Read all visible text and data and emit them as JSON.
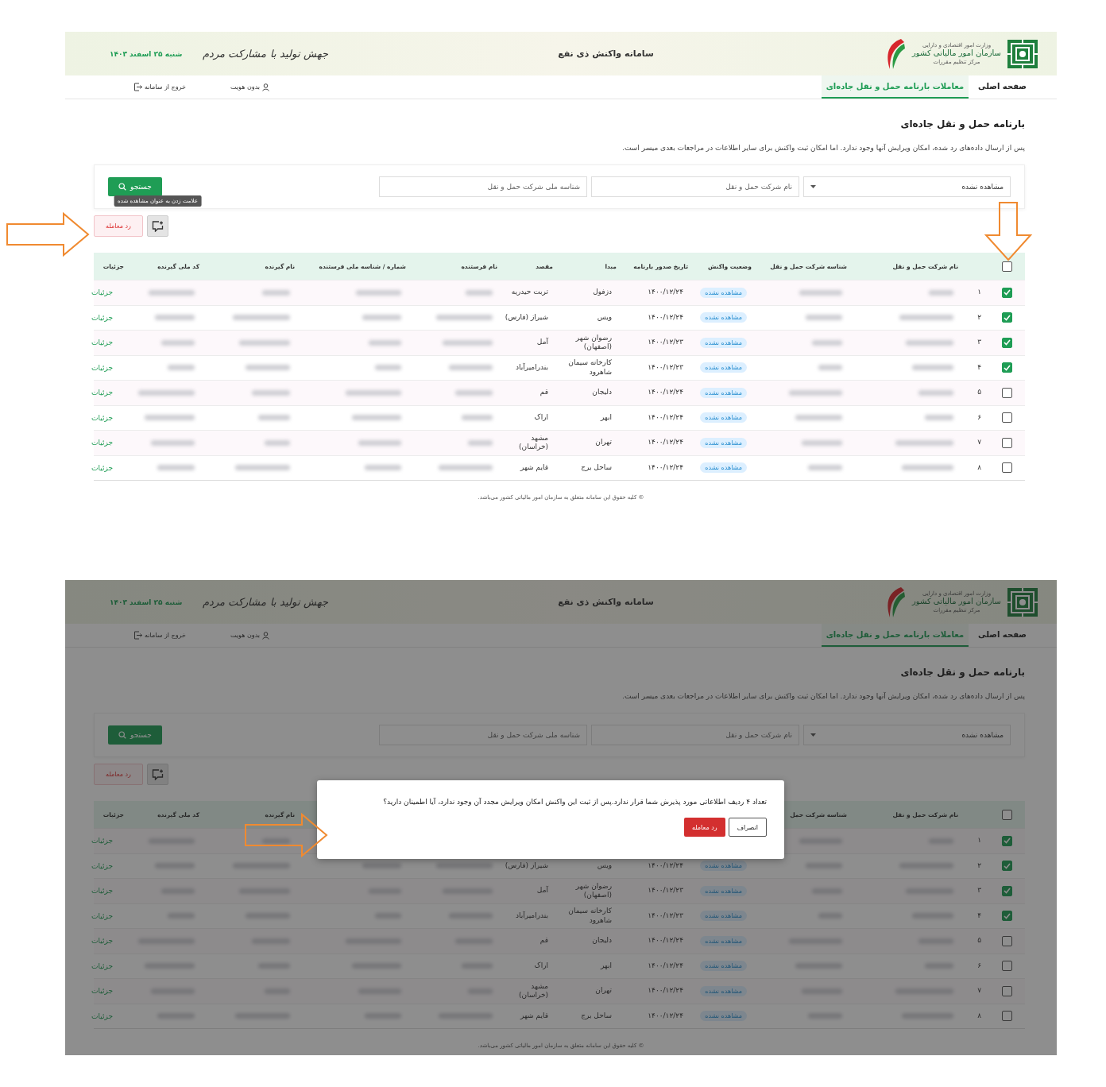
{
  "screens": [
    {
      "dimmed": false,
      "banner": {
        "ministry": "وزارت امور اقتصادی و دارایی",
        "organization": "سازمان امور مالیاتی کشور",
        "unit": "مرکز تنظیم مقررات",
        "title": "سامانه واکنش ذی نفع",
        "slogan": "جهش تولید با مشارکت مردم",
        "date": "شنبه ۲۵ اسفند ۱۴۰۳"
      },
      "nav": {
        "items": [
          {
            "label": "صفحه اصلی",
            "selected": false
          },
          {
            "label": "معاملات بارنامه حمل و نقل جاده‌ای",
            "selected": true
          }
        ],
        "user": "بدون هویت",
        "logout": "خروج از سامانه"
      },
      "page_title": "بارنامه حمل و نقل جاده‌ای",
      "description": "پس از ارسال داده‌های رد شده، امکان ویرایش آنها وجود ندارد. اما امکان ثبت واکنش برای سایر اطلاعات در مراجعات بعدی میسر است.",
      "filters": {
        "status": "مشاهده نشده",
        "company_name": {
          "placeholder": "نام شرکت حمل و نقل"
        },
        "company_id": {
          "placeholder": "شناسه ملی شرکت حمل و نقل"
        },
        "search_button": "جستجو"
      },
      "tooltip": "علامت زدن به عنوان مشاهده شده",
      "reject_button": "رد معامله",
      "table": {
        "header_checked": false,
        "columns": [
          null,
          null,
          "نام شرکت حمل و نقل",
          "شناسه شرکت حمل و نقل",
          "وضعیت واکنش",
          "تاریخ صدور بارنامه",
          "مبدا",
          "مقصد",
          "نام فرستنده",
          "شماره / شناسه ملی فرستنده",
          "نام گیرنده",
          "کد ملی گیرنده",
          "جزئیات"
        ],
        "rows": [
          {
            "checked": true,
            "number": "۱",
            "status": "مشاهده نشده",
            "date": "۱۴۰۰/۱۲/۲۴",
            "origin": "دزفول",
            "destination": "تربت حیدریه",
            "details": "جزئیات"
          },
          {
            "checked": true,
            "number": "۲",
            "status": "مشاهده نشده",
            "date": "۱۴۰۰/۱۲/۲۴",
            "origin": "ویس",
            "destination": "شیراز (فارس)",
            "details": "جزئیات"
          },
          {
            "checked": true,
            "number": "۳",
            "status": "مشاهده نشده",
            "date": "۱۴۰۰/۱۲/۲۳",
            "origin": "رضوان شهر (اصفهان)",
            "destination": "آمل",
            "details": "جزئیات"
          },
          {
            "checked": true,
            "number": "۴",
            "status": "مشاهده نشده",
            "date": "۱۴۰۰/۱۲/۲۳",
            "origin": "کارخانه سیمان شاهرود",
            "destination": "بندرامیرآباد",
            "details": "جزئیات"
          },
          {
            "checked": false,
            "number": "۵",
            "status": "مشاهده نشده",
            "date": "۱۴۰۰/۱۲/۲۴",
            "origin": "دلیجان",
            "destination": "قم",
            "details": "جزئیات"
          },
          {
            "checked": false,
            "number": "۶",
            "status": "مشاهده نشده",
            "date": "۱۴۰۰/۱۲/۲۴",
            "origin": "ابهر",
            "destination": "اراک",
            "details": "جزئیات"
          },
          {
            "checked": false,
            "number": "۷",
            "status": "مشاهده نشده",
            "date": "۱۴۰۰/۱۲/۲۴",
            "origin": "تهران",
            "destination": "مشهد (خراسان)",
            "details": "جزئیات"
          },
          {
            "checked": false,
            "number": "۸",
            "status": "مشاهده نشده",
            "date": "۱۴۰۰/۱۲/۲۴",
            "origin": "ساحل برج",
            "destination": "قایم شهر",
            "details": "جزئیات"
          }
        ]
      },
      "footer": "© کلیه حقوق این سامانه متعلق به سازمان امور مالیاتی کشور می‌باشد."
    },
    {
      "dimmed": true,
      "banner": {
        "ministry": "وزارت امور اقتصادی و دارایی",
        "organization": "سازمان امور مالیاتی کشور",
        "unit": "مرکز تنظیم مقررات",
        "title": "سامانه واکنش ذی نفع",
        "slogan": "جهش تولید با مشارکت مردم",
        "date": "شنبه ۲۵ اسفند ۱۴۰۳"
      },
      "nav": {
        "items": [
          {
            "label": "صفحه اصلی",
            "selected": false
          },
          {
            "label": "معاملات بارنامه حمل و نقل جاده‌ای",
            "selected": true
          }
        ],
        "user": "بدون هویت",
        "logout": "خروج از سامانه"
      },
      "page_title": "بارنامه حمل و نقل جاده‌ای",
      "description": "پس از ارسال داده‌های رد شده، امکان ویرایش آنها وجود ندارد. اما امکان ثبت واکنش برای سایر اطلاعات در مراجعات بعدی میسر است.",
      "filters": {
        "status": "مشاهده نشده",
        "company_name": {
          "placeholder": "نام شرکت حمل و نقل"
        },
        "company_id": {
          "placeholder": "شناسه ملی شرکت حمل و نقل"
        },
        "search_button": "جستجو"
      },
      "reject_button": "رد معامله",
      "table": {
        "header_checked": false,
        "columns": [
          null,
          null,
          "نام شرکت حمل و نقل",
          "شناسه شرکت حمل",
          null,
          null,
          null,
          null,
          null,
          null,
          "نام گیرنده",
          "کد ملی گیرنده",
          "جزئیات"
        ],
        "rows": [
          {
            "checked": true,
            "number": "۱",
            "covered": true,
            "details": "جزئیات"
          },
          {
            "checked": true,
            "number": "۲",
            "covered": false,
            "status": "مشاهده نشده",
            "date": "۱۴۰۰/۱۲/۲۴",
            "origin": "ویس",
            "destination": "شیراز (فارس)",
            "details": "جزئیات"
          },
          {
            "checked": true,
            "number": "۳",
            "covered": false,
            "status": "مشاهده نشده",
            "date": "۱۴۰۰/۱۲/۲۳",
            "origin": "رضوان شهر (اصفهان)",
            "destination": "آمل",
            "details": "جزئیات"
          },
          {
            "checked": true,
            "number": "۴",
            "covered": false,
            "status": "مشاهده نشده",
            "date": "۱۴۰۰/۱۲/۲۳",
            "origin": "کارخانه سیمان شاهرود",
            "destination": "بندرامیرآباد",
            "details": "جزئیات"
          },
          {
            "checked": false,
            "number": "۵",
            "covered": false,
            "status": "مشاهده نشده",
            "date": "۱۴۰۰/۱۲/۲۴",
            "origin": "دلیجان",
            "destination": "قم",
            "details": "جزئیات"
          },
          {
            "checked": false,
            "number": "۶",
            "covered": false,
            "status": "مشاهده نشده",
            "date": "۱۴۰۰/۱۲/۲۴",
            "origin": "ابهر",
            "destination": "اراک",
            "details": "جزئیات"
          },
          {
            "checked": false,
            "number": "۷",
            "covered": false,
            "status": "مشاهده نشده",
            "date": "۱۴۰۰/۱۲/۲۴",
            "origin": "تهران",
            "destination": "مشهد (خراسان)",
            "details": "جزئیات"
          },
          {
            "checked": false,
            "number": "۸",
            "covered": false,
            "status": "مشاهده نشده",
            "date": "۱۴۰۰/۱۲/۲۴",
            "origin": "ساحل برج",
            "destination": "قایم شهر",
            "details": "جزئیات"
          }
        ]
      },
      "dialog": {
        "message": "تعداد ۴ ردیف اطلاعاتی مورد پذیرش شما قرار ندارد.پس از ثبت این واکنش امکان ویرایش مجدد آن وجود ندارد، آیا اطمینان دارید؟",
        "confirm": "رد معامله",
        "cancel": "انصراف"
      },
      "footer": "© کلیه حقوق این سامانه متعلق به سازمان امور مالیاتی کشور می‌باشد."
    }
  ]
}
